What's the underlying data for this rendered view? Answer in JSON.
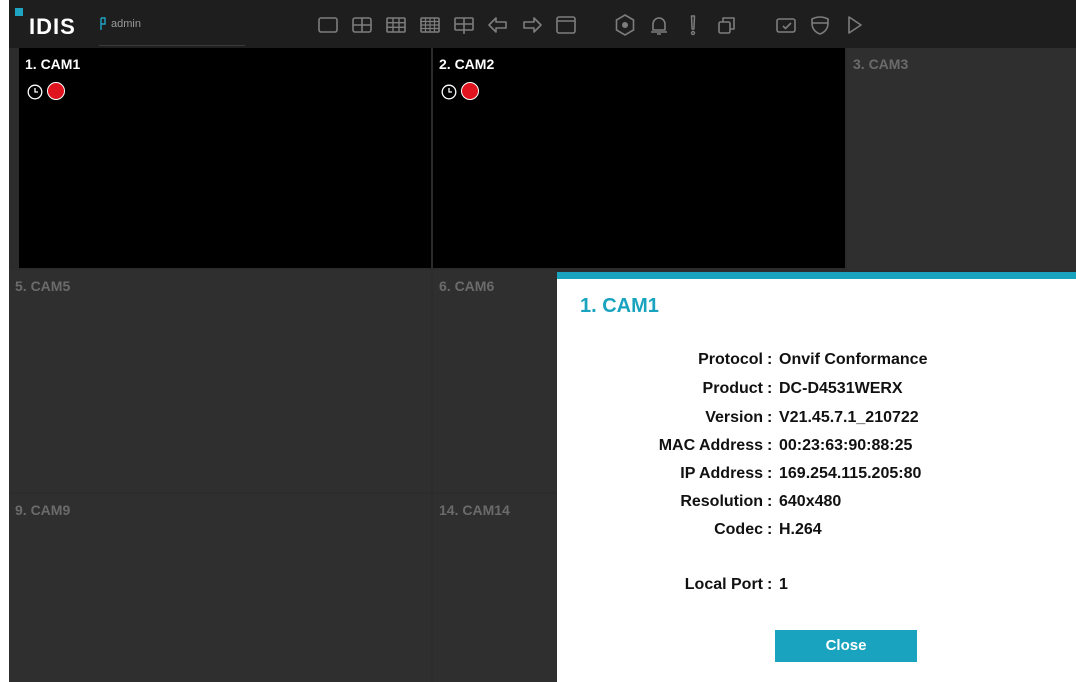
{
  "app": {
    "brand": "IDIS",
    "user": "admin",
    "accent_color": "#1aa3bf",
    "record_color": "#e0141e"
  },
  "toolbar": {
    "icons": [
      "layout-1x1-icon",
      "layout-2x2-icon",
      "layout-3x3-icon",
      "layout-4x4-icon",
      "layout-custom-icon",
      "previous-group-icon",
      "next-group-icon",
      "window-icon",
      "camera-menu-icon",
      "alarm-bell-icon",
      "alert-icon",
      "copy-icon",
      "export-icon",
      "shield-icon",
      "play-icon"
    ]
  },
  "cameras": [
    {
      "label": "1. CAM1",
      "live": true,
      "schedule_icon": "clock-icon",
      "recording": true
    },
    {
      "label": "2. CAM2",
      "live": true,
      "schedule_icon": "clock-icon",
      "recording": true
    },
    {
      "label": "3. CAM3",
      "live": false
    },
    {
      "label": "5. CAM5",
      "live": false
    },
    {
      "label": "6. CAM6",
      "live": false
    },
    {
      "label": "9. CAM9",
      "live": false
    },
    {
      "label": "14. CAM14",
      "live": false
    }
  ],
  "dialog": {
    "title": "1. CAM1",
    "rows": [
      {
        "key": "Protocol",
        "value": "Onvif Conformance"
      },
      {
        "key": "Product",
        "value": "DC-D4531WERX"
      },
      {
        "key": "Version",
        "value": "V21.45.7.1_210722"
      },
      {
        "key": "MAC Address",
        "value": "00:23:63:90:88:25"
      },
      {
        "key": "IP Address",
        "value": "169.254.115.205:80"
      },
      {
        "key": "Resolution",
        "value": "640x480"
      },
      {
        "key": "Codec",
        "value": "H.264"
      },
      {
        "key": "Local Port",
        "value": "1"
      }
    ],
    "close_label": "Close"
  }
}
